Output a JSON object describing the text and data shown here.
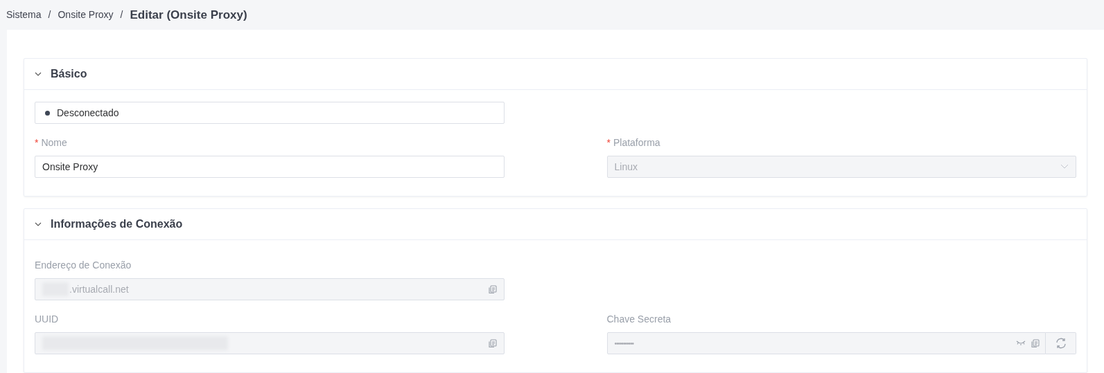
{
  "breadcrumb": [
    {
      "label": "Sistema",
      "separator": "/"
    },
    {
      "label": "Onsite Proxy",
      "separator": "/"
    }
  ],
  "required_mark": "*",
  "title": "Editar (Onsite Proxy)",
  "sections": [
    {
      "title": "Básico",
      "expanded": true,
      "rows": [
        [
          {
            "kind": "status",
            "label": "Desconectado",
            "color": "#3f4756"
          }
        ],
        [
          {
            "kind": "text",
            "label": "Nome",
            "required": true,
            "value": "Onsite Proxy",
            "disabled": false
          },
          {
            "kind": "select",
            "label": "Plataforma",
            "required": true,
            "value": "Linux",
            "disabled": true
          }
        ]
      ]
    },
    {
      "title": "Informações de Conexão",
      "expanded": true,
      "rows": [
        [
          {
            "kind": "copy",
            "label": "Endereço de Conexão",
            "value": ".virtualcall.net",
            "redacted": true,
            "disabled": true
          }
        ],
        [
          {
            "kind": "copy",
            "label": "UUID",
            "redacted": true,
            "disabled": true
          },
          {
            "kind": "secret",
            "label": "Chave Secreta",
            "value": "•••••••••••",
            "disabled": true
          }
        ]
      ]
    }
  ]
}
